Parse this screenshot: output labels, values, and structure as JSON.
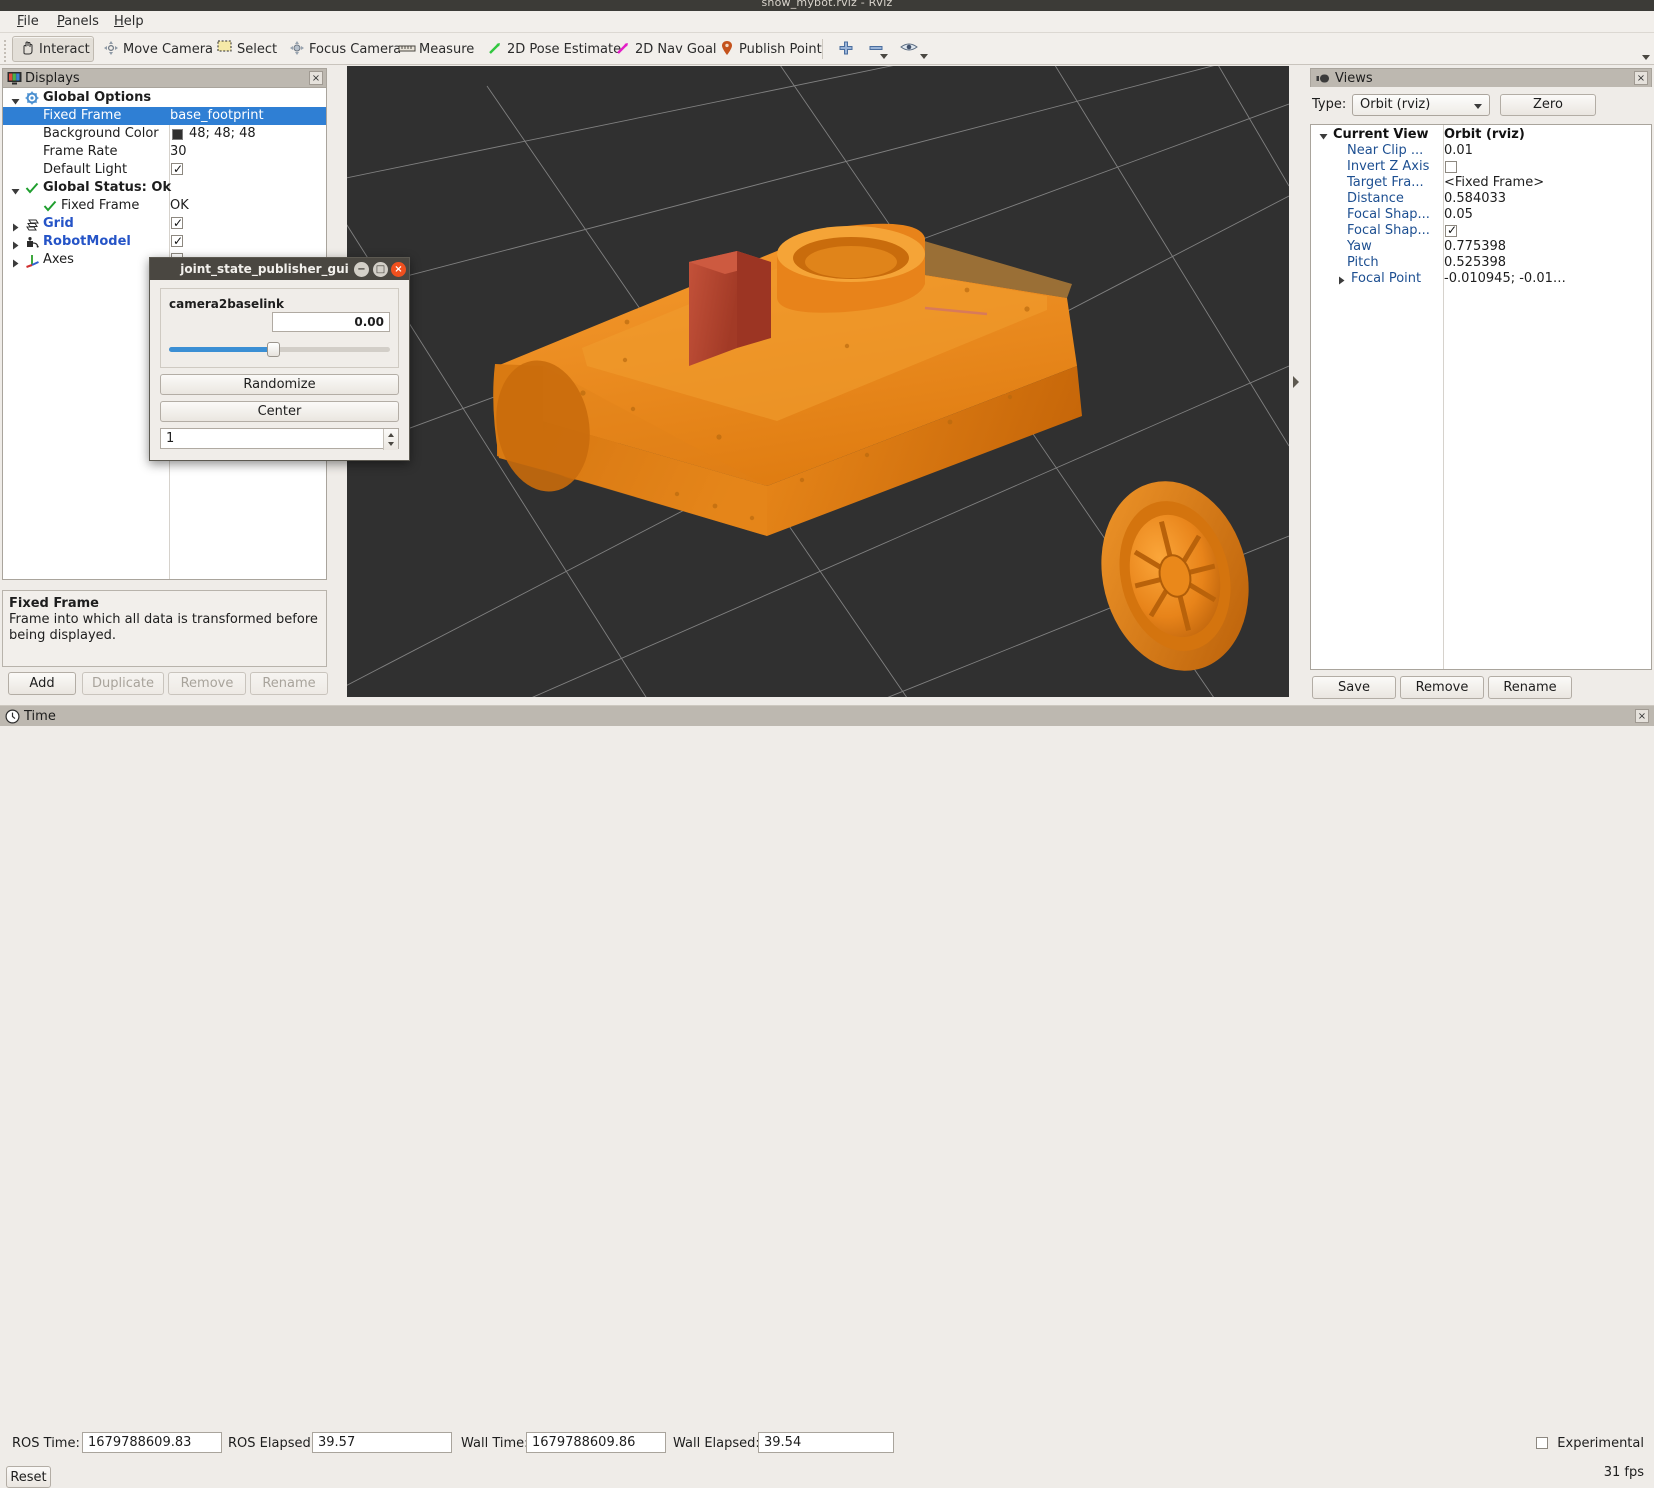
{
  "window": {
    "title": "show_mybot.rviz - RViz"
  },
  "menu": {
    "items": [
      {
        "label": "File",
        "accel": "F"
      },
      {
        "label": "Panels",
        "accel": "P"
      },
      {
        "label": "Help",
        "accel": "H"
      }
    ]
  },
  "toolbar": {
    "items": [
      {
        "label": "Interact",
        "icon": "hand-icon",
        "active": true
      },
      {
        "label": "Move Camera",
        "icon": "move-camera-icon",
        "active": false
      },
      {
        "label": "Select",
        "icon": "select-box-icon",
        "active": false
      },
      {
        "label": "Focus Camera",
        "icon": "focus-camera-icon",
        "active": false
      },
      {
        "label": "Measure",
        "icon": "ruler-icon",
        "active": false
      },
      {
        "label": "2D Pose Estimate",
        "icon": "green-arrow-icon",
        "active": false
      },
      {
        "label": "2D Nav Goal",
        "icon": "magenta-arrow-icon",
        "active": false
      },
      {
        "label": "Publish Point",
        "icon": "map-pin-icon",
        "active": false
      }
    ],
    "extra": [
      {
        "name": "add-tool-button",
        "icon": "plus-icon"
      },
      {
        "name": "remove-tool-button",
        "icon": "minus-icon"
      },
      {
        "name": "tool-properties-button",
        "icon": "eye-icon"
      }
    ]
  },
  "displays": {
    "title": "Displays",
    "title_icon": "displays-icon",
    "close_icon": "×",
    "rows": [
      {
        "indent": 0,
        "arrow": "down",
        "icon": "gear-icon",
        "name": "Global Options",
        "value": "",
        "type": "group",
        "selected": false
      },
      {
        "indent": 1,
        "arrow": "none",
        "icon": "",
        "name": "Fixed Frame",
        "value": "base_footprint",
        "type": "text",
        "selected": true
      },
      {
        "indent": 1,
        "arrow": "none",
        "icon": "",
        "name": "Background Color",
        "value": "48; 48; 48",
        "type": "color",
        "selected": false,
        "swatch": "#303030"
      },
      {
        "indent": 1,
        "arrow": "none",
        "icon": "",
        "name": "Frame Rate",
        "value": "30",
        "type": "text",
        "selected": false
      },
      {
        "indent": 1,
        "arrow": "none",
        "icon": "",
        "name": "Default Light",
        "value": "",
        "type": "checkbox",
        "checked": true,
        "selected": false
      },
      {
        "indent": 0,
        "arrow": "down",
        "icon": "check-icon",
        "name": "Global Status: Ok",
        "value": "",
        "type": "group",
        "selected": false
      },
      {
        "indent": 1,
        "arrow": "none",
        "icon": "check-icon",
        "name": "Fixed Frame",
        "value": "OK",
        "type": "text",
        "selected": false
      },
      {
        "indent": 0,
        "arrow": "right",
        "icon": "grid-icon",
        "name": "Grid",
        "value": "",
        "type": "checkbox",
        "checked": true,
        "selected": false,
        "blue": true
      },
      {
        "indent": 0,
        "arrow": "right",
        "icon": "robot-icon",
        "name": "RobotModel",
        "value": "",
        "type": "checkbox",
        "checked": true,
        "selected": false,
        "blue": true
      },
      {
        "indent": 0,
        "arrow": "right",
        "icon": "axes-icon",
        "name": "Axes",
        "value": "",
        "type": "checkbox",
        "checked": false,
        "selected": false,
        "blue": false
      }
    ],
    "help": {
      "title": "Fixed Frame",
      "body": "Frame into which all data is transformed before being displayed."
    },
    "buttons": [
      {
        "label": "Add",
        "enabled": true
      },
      {
        "label": "Duplicate",
        "enabled": false
      },
      {
        "label": "Remove",
        "enabled": false
      },
      {
        "label": "Rename",
        "enabled": false
      }
    ]
  },
  "views": {
    "title": "Views",
    "title_icon": "views-icon",
    "close_icon": "×",
    "type_label": "Type:",
    "type_value": "Orbit (rviz)",
    "zero_button": "Zero",
    "rows": [
      {
        "indent": 0,
        "arrow": "down",
        "name": "Current View",
        "value": "Orbit (rviz)",
        "type": "header"
      },
      {
        "indent": 1,
        "arrow": "none",
        "name": "Near Clip ...",
        "value": "0.01",
        "type": "text"
      },
      {
        "indent": 1,
        "arrow": "none",
        "name": "Invert Z Axis",
        "value": "",
        "type": "checkbox",
        "checked": false
      },
      {
        "indent": 1,
        "arrow": "none",
        "name": "Target Fra...",
        "value": "<Fixed Frame>",
        "type": "text"
      },
      {
        "indent": 1,
        "arrow": "none",
        "name": "Distance",
        "value": "0.584033",
        "type": "text"
      },
      {
        "indent": 1,
        "arrow": "none",
        "name": "Focal Shap...",
        "value": "0.05",
        "type": "text"
      },
      {
        "indent": 1,
        "arrow": "none",
        "name": "Focal Shap...",
        "value": "",
        "type": "checkbox",
        "checked": true
      },
      {
        "indent": 1,
        "arrow": "none",
        "name": "Yaw",
        "value": "0.775398",
        "type": "text"
      },
      {
        "indent": 1,
        "arrow": "none",
        "name": "Pitch",
        "value": "0.525398",
        "type": "text"
      },
      {
        "indent": 1,
        "arrow": "right",
        "name": "Focal Point",
        "value": "-0.010945; -0.01…",
        "type": "text"
      }
    ],
    "buttons": [
      {
        "label": "Save"
      },
      {
        "label": "Remove"
      },
      {
        "label": "Rename"
      }
    ]
  },
  "joint_publisher": {
    "title": "joint_state_publisher_gui",
    "window_buttons": [
      {
        "name": "minimize-button",
        "glyph": "−",
        "color": "#d4d0c8"
      },
      {
        "name": "maximize-button",
        "glyph": "□",
        "color": "#d4d0c8"
      },
      {
        "name": "close-button",
        "glyph": "×",
        "color": "#f0501e"
      }
    ],
    "joint": {
      "name": "camera2baselink",
      "value": "0.00",
      "slider_percent": 47
    },
    "randomize_label": "Randomize",
    "center_label": "Center",
    "spin_value": "1"
  },
  "time": {
    "title": "Time",
    "title_icon": "clock-icon",
    "close_icon": "×",
    "fields": [
      {
        "label": "ROS Time:",
        "value": "1679788609.83"
      },
      {
        "label": "ROS Elapsed:",
        "value": "39.57"
      },
      {
        "label": "Wall Time:",
        "value": "1679788609.86"
      },
      {
        "label": "Wall Elapsed:",
        "value": "39.54"
      }
    ],
    "reset_label": "Reset",
    "experimental_label": "Experimental",
    "experimental_checked": false,
    "fps": "31 fps"
  },
  "viewport": {
    "background_color": "#303030",
    "grid_color": "#9a9a9a",
    "robot_color": "#e8801a",
    "robot_accent_color": "#b8472e"
  }
}
